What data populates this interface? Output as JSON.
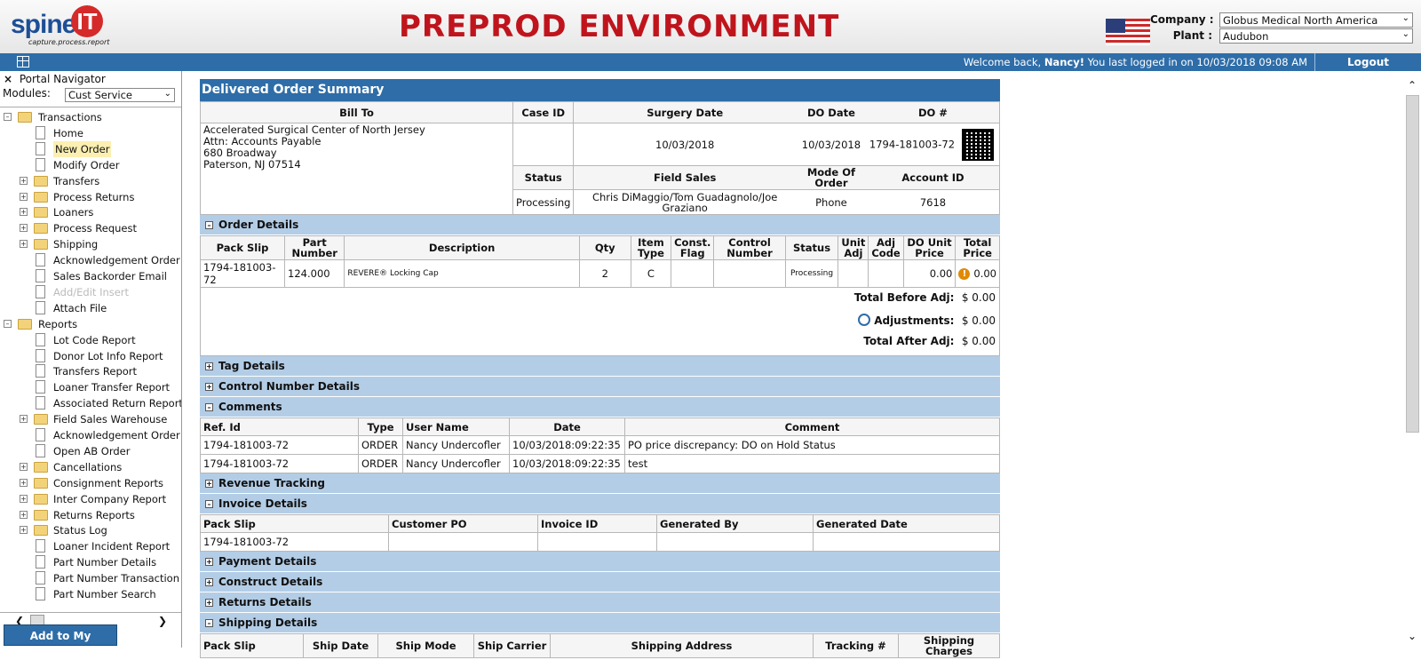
{
  "header": {
    "logo_text": "spine",
    "logo_mark": "IT",
    "logo_tagline": "capture.process.report",
    "environment_banner": "PREPROD ENVIRONMENT",
    "company_label": "Company :",
    "company_value": "Globus Medical North America",
    "plant_label": "Plant :",
    "plant_value": "Audubon",
    "flag_icon": "us-flag-icon"
  },
  "topbar": {
    "welcome_prefix": "Welcome back,",
    "user": "Nancy!",
    "last_login": "You last logged in on 10/03/2018 09:08 AM",
    "logout": "Logout"
  },
  "sidebar": {
    "title": "Portal Navigator",
    "modules_label": "Modules:",
    "modules_value": "Cust Service",
    "transactions": "Transactions",
    "items_transactions": [
      {
        "label": "Home",
        "type": "doc"
      },
      {
        "label": "New Order",
        "type": "doc",
        "highlight": true
      },
      {
        "label": "Modify Order",
        "type": "doc"
      },
      {
        "label": "Transfers",
        "type": "folder"
      },
      {
        "label": "Process Returns",
        "type": "folder"
      },
      {
        "label": "Loaners",
        "type": "folder"
      },
      {
        "label": "Process Request",
        "type": "folder"
      },
      {
        "label": "Shipping",
        "type": "folder"
      },
      {
        "label": "Acknowledgement Order",
        "type": "doc"
      },
      {
        "label": "Sales Backorder Email",
        "type": "doc"
      },
      {
        "label": "Add/Edit Insert",
        "type": "doc",
        "disabled": true
      },
      {
        "label": "Attach File",
        "type": "doc"
      }
    ],
    "reports": "Reports",
    "items_reports": [
      {
        "label": "Lot Code Report",
        "type": "doc"
      },
      {
        "label": "Donor Lot Info Report",
        "type": "doc"
      },
      {
        "label": "Transfers Report",
        "type": "doc"
      },
      {
        "label": "Loaner Transfer Report",
        "type": "doc"
      },
      {
        "label": "Associated Return Report",
        "type": "doc"
      },
      {
        "label": "Field Sales Warehouse",
        "type": "folder"
      },
      {
        "label": "Acknowledgement Order",
        "type": "doc"
      },
      {
        "label": "Open AB Order",
        "type": "doc"
      },
      {
        "label": "Cancellations",
        "type": "folder"
      },
      {
        "label": "Consignment Reports",
        "type": "folder"
      },
      {
        "label": "Inter Company Report",
        "type": "folder"
      },
      {
        "label": "Returns Reports",
        "type": "folder"
      },
      {
        "label": "Status Log",
        "type": "folder"
      },
      {
        "label": "Loaner Incident Report",
        "type": "doc"
      },
      {
        "label": "Part Number Details",
        "type": "doc"
      },
      {
        "label": "Part Number Transaction",
        "type": "doc"
      },
      {
        "label": "Part Number Search",
        "type": "doc"
      }
    ],
    "favorites_button": "Add to My Favorites"
  },
  "summary": {
    "title": "Delivered Order Summary",
    "bill_to_header": "Bill To",
    "bill_to_lines": [
      "Accelerated Surgical Center of North Jersey",
      "Attn: Accounts Payable",
      "680 Broadway",
      "Paterson, NJ 07514"
    ],
    "case_id_header": "Case ID",
    "case_id": "",
    "surgery_date_header": "Surgery Date",
    "surgery_date": "10/03/2018",
    "do_date_header": "DO Date",
    "do_date": "10/03/2018",
    "do_num_header": "DO #",
    "do_num": "1794-181003-72",
    "status_header": "Status",
    "status": "Processing",
    "field_sales_header": "Field Sales",
    "field_sales": "Chris DiMaggio/Tom Guadagnolo/Joe Graziano",
    "mode_header": "Mode Of Order",
    "mode": "Phone",
    "account_header": "Account ID",
    "account": "7618"
  },
  "order_details": {
    "title": "Order Details",
    "columns": [
      "Pack Slip",
      "Part Number",
      "Description",
      "Qty",
      "Item Type",
      "Const. Flag",
      "Control Number",
      "Status",
      "Unit Adj",
      "Adj Code",
      "DO Unit Price",
      "Total Price"
    ],
    "row": [
      "1794-181003-72",
      "124.000",
      "REVERE® Locking Cap",
      "2",
      "C",
      "",
      "",
      "Processing",
      "",
      "",
      "0.00",
      "0.00"
    ],
    "total_before_label": "Total Before Adj:",
    "total_before": "$ 0.00",
    "adjustments_label": "Adjustments:",
    "adjustments": "$ 0.00",
    "total_after_label": "Total After Adj:",
    "total_after": "$ 0.00"
  },
  "sections": {
    "tag": "Tag Details",
    "control": "Control Number Details",
    "comments": "Comments",
    "revenue": "Revenue Tracking",
    "invoice": "Invoice Details",
    "payment": "Payment Details",
    "construct": "Construct Details",
    "returns": "Returns Details",
    "shipping": "Shipping Details"
  },
  "comments": {
    "columns": [
      "Ref. Id",
      "Type",
      "User Name",
      "Date",
      "Comment"
    ],
    "rows": [
      [
        "1794-181003-72",
        "ORDER",
        "Nancy Undercofler",
        "10/03/2018:09:22:35",
        "PO price discrepancy: DO on Hold Status"
      ],
      [
        "1794-181003-72",
        "ORDER",
        "Nancy Undercofler",
        "10/03/2018:09:22:35",
        "test"
      ]
    ]
  },
  "invoice": {
    "columns": [
      "Pack Slip",
      "Customer PO",
      "Invoice ID",
      "Generated By",
      "Generated Date"
    ],
    "row": [
      "1794-181003-72",
      "",
      "",
      "",
      ""
    ]
  },
  "shipping": {
    "columns": [
      "Pack Slip",
      "Ship Date",
      "Ship Mode",
      "Ship Carrier",
      "Shipping Address",
      "Tracking #",
      "Shipping Charges"
    ]
  },
  "colors": {
    "header_blue": "#2e6da8",
    "section_blue": "#b3cde6",
    "banner_red": "#c0141c"
  }
}
